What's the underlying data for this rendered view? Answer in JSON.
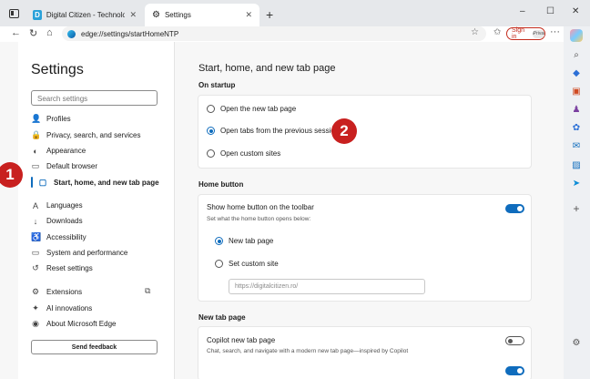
{
  "browser": {
    "tabs": [
      {
        "title": "Digital Citizen - Technology expla",
        "favicon": "D"
      },
      {
        "title": "Settings"
      }
    ],
    "address": "edge://settings/startHomeNTP",
    "signin_label": "Sign in",
    "signin_badge": "InPrivate",
    "new_tab_symbol": "+",
    "window_controls": [
      "–",
      "☐",
      "✕"
    ]
  },
  "sidebar": {
    "title": "Settings",
    "search_placeholder": "Search settings",
    "items": [
      {
        "label": "Profiles",
        "icon": "profile-icon",
        "glyph": "👤"
      },
      {
        "label": "Privacy, search, and services",
        "icon": "lock-icon",
        "glyph": "🔒"
      },
      {
        "label": "Appearance",
        "icon": "palette-icon",
        "glyph": "◐"
      },
      {
        "label": "Default browser",
        "icon": "browser-icon",
        "glyph": "▭"
      },
      {
        "label": "Start, home, and new tab page",
        "icon": "home-icon",
        "glyph": "▢"
      },
      {
        "label": "Languages",
        "icon": "language-icon",
        "glyph": "A"
      },
      {
        "label": "Downloads",
        "icon": "download-icon",
        "glyph": "↓"
      },
      {
        "label": "Accessibility",
        "icon": "accessibility-icon",
        "glyph": "♿"
      },
      {
        "label": "System and performance",
        "icon": "system-icon",
        "glyph": "▭"
      },
      {
        "label": "Reset settings",
        "icon": "reset-icon",
        "glyph": "↺"
      },
      {
        "label": "Extensions",
        "icon": "extensions-icon",
        "glyph": "⚙"
      },
      {
        "label": "AI innovations",
        "icon": "ai-icon",
        "glyph": "✦"
      },
      {
        "label": "About Microsoft Edge",
        "icon": "edge-icon",
        "glyph": "◉"
      }
    ],
    "active_index": 4,
    "feedback_label": "Send feedback"
  },
  "main": {
    "title": "Start, home, and new tab page",
    "startup": {
      "heading": "On startup",
      "options": [
        "Open the new tab page",
        "Open tabs from the previous session",
        "Open custom sites"
      ],
      "selected": 1
    },
    "home_button": {
      "heading": "Home button",
      "toggle_label": "Show home button on the toolbar",
      "toggle_on": true,
      "description": "Set what the home button opens below:",
      "options": [
        "New tab page",
        "Set custom site"
      ],
      "selected": 0,
      "url_placeholder": "https://digitalcitizen.ro/"
    },
    "new_tab": {
      "heading": "New tab page",
      "copilot_label": "Copilot new tab page",
      "copilot_description": "Chat, search, and navigate with a modern new tab page—inspired by Copilot",
      "copilot_on": false
    }
  },
  "callouts": [
    "1",
    "2"
  ],
  "colors": {
    "accent": "#0f6cbd",
    "callout": "#c8201f"
  }
}
